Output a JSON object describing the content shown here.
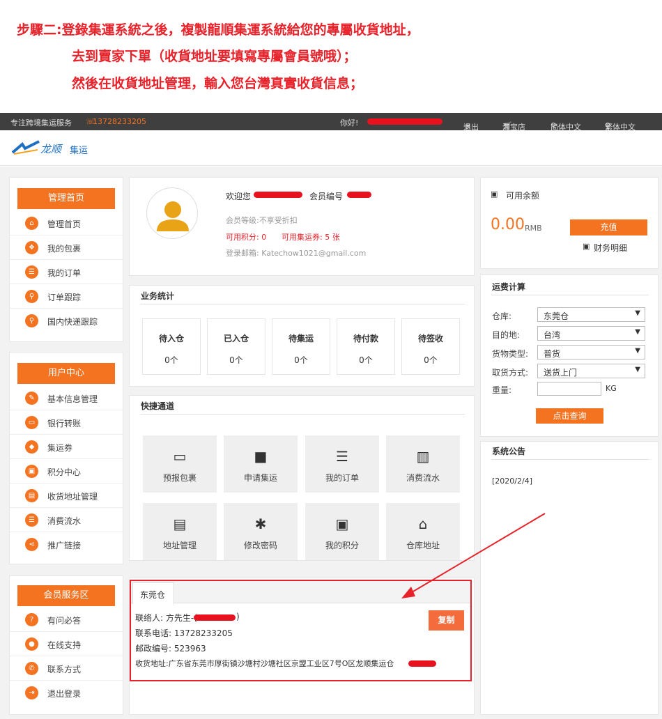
{
  "instructions": {
    "line1": "步驟二:登錄集運系統之後，複製龍順集運系統給您的專屬收貨地址，",
    "line2": "去到賣家下單（收貨地址要填寫專屬會員號哦）；",
    "line3": "然後在收貨地址管理，輸入您台灣真實收貨信息；"
  },
  "topbar": {
    "slogan": "专注跨境集运服务",
    "phone": "13728233205",
    "greeting": "你好!",
    "logout": "退出",
    "taobao": "淘宝店",
    "simplified": "简体中文",
    "traditional": "繁体中文"
  },
  "logo": {
    "brand": "龙顺",
    "suffix": "集运"
  },
  "sidebar": {
    "group1": {
      "title": "管理首页",
      "items": [
        {
          "label": "管理首页",
          "icon": "home-icon"
        },
        {
          "label": "我的包裹",
          "icon": "package-icon"
        },
        {
          "label": "我的订单",
          "icon": "list-icon"
        },
        {
          "label": "订单跟踪",
          "icon": "search-icon"
        },
        {
          "label": "国内快递跟踪",
          "icon": "search-icon"
        }
      ]
    },
    "group2": {
      "title": "用户中心",
      "items": [
        {
          "label": "基本信息管理",
          "icon": "edit-icon"
        },
        {
          "label": "银行转账",
          "icon": "card-icon"
        },
        {
          "label": "集运券",
          "icon": "tag-icon"
        },
        {
          "label": "积分中心",
          "icon": "gift-icon"
        },
        {
          "label": "收货地址管理",
          "icon": "id-card-icon"
        },
        {
          "label": "消费流水",
          "icon": "list-icon"
        },
        {
          "label": "推广链接",
          "icon": "share-icon"
        }
      ]
    },
    "group3": {
      "title": "会员服务区",
      "items": [
        {
          "label": "有问必答",
          "icon": "question-icon"
        },
        {
          "label": "在线支持",
          "icon": "user-icon"
        },
        {
          "label": "联系方式",
          "icon": "phone-icon"
        },
        {
          "label": "退出登录",
          "icon": "logout-icon"
        }
      ]
    }
  },
  "profile": {
    "welcome": "欢迎您",
    "member_no_label": "会员编号",
    "level": "会员等级:不享受折扣",
    "points_label": "可用积分: 0",
    "coupon_label": "可用集运券: 5 张",
    "email": "登录邮箱: Katechow1021@gmail.com"
  },
  "stats": {
    "title": "业务统计",
    "items": [
      {
        "label": "待入仓",
        "value": "0个"
      },
      {
        "label": "已入仓",
        "value": "0个"
      },
      {
        "label": "待集运",
        "value": "0个"
      },
      {
        "label": "待付款",
        "value": "0个"
      },
      {
        "label": "待签收",
        "value": "0个"
      }
    ]
  },
  "shortcuts": {
    "title": "快捷通道",
    "items": [
      {
        "label": "预报包裹",
        "glyph": "▭"
      },
      {
        "label": "申请集运",
        "glyph": "■"
      },
      {
        "label": "我的订单",
        "glyph": "☰"
      },
      {
        "label": "消费流水",
        "glyph": "▥"
      },
      {
        "label": "地址管理",
        "glyph": "▤"
      },
      {
        "label": "修改密码",
        "glyph": "✱"
      },
      {
        "label": "我的积分",
        "glyph": "▣"
      },
      {
        "label": "仓库地址",
        "glyph": "⌂"
      }
    ]
  },
  "address": {
    "tab": "东莞仓",
    "contact": "联络人: 方先生-(",
    "contact_end": ")",
    "phone": "联系电话: 13728233205",
    "postcode": "邮政编号: 523963",
    "address": "收货地址:广东省东莞市厚街镇沙塘村沙塘社区京盟工业区7号O区龙顺集运仓",
    "copy_button": "复制"
  },
  "balance": {
    "label": "可用余额",
    "amount": "0.00",
    "currency": "RMB",
    "recharge": "充值",
    "details": "财务明细"
  },
  "calculator": {
    "title": "运费计算",
    "warehouse_label": "仓库:",
    "warehouse_value": "东莞仓",
    "destination_label": "目的地:",
    "destination_value": "台湾",
    "goods_label": "货物类型:",
    "goods_value": "普货",
    "pickup_label": "取货方式:",
    "pickup_value": "送货上门",
    "weight_label": "重量:",
    "weight_unit": "KG",
    "query_button": "点击查询"
  },
  "notice": {
    "title": "系统公告",
    "date": "[2020/2/4]"
  },
  "colors": {
    "accent": "#f47321",
    "highlight": "#e8222a",
    "topbar": "#3f3f3f",
    "brand_blue": "#1d6fc4"
  }
}
